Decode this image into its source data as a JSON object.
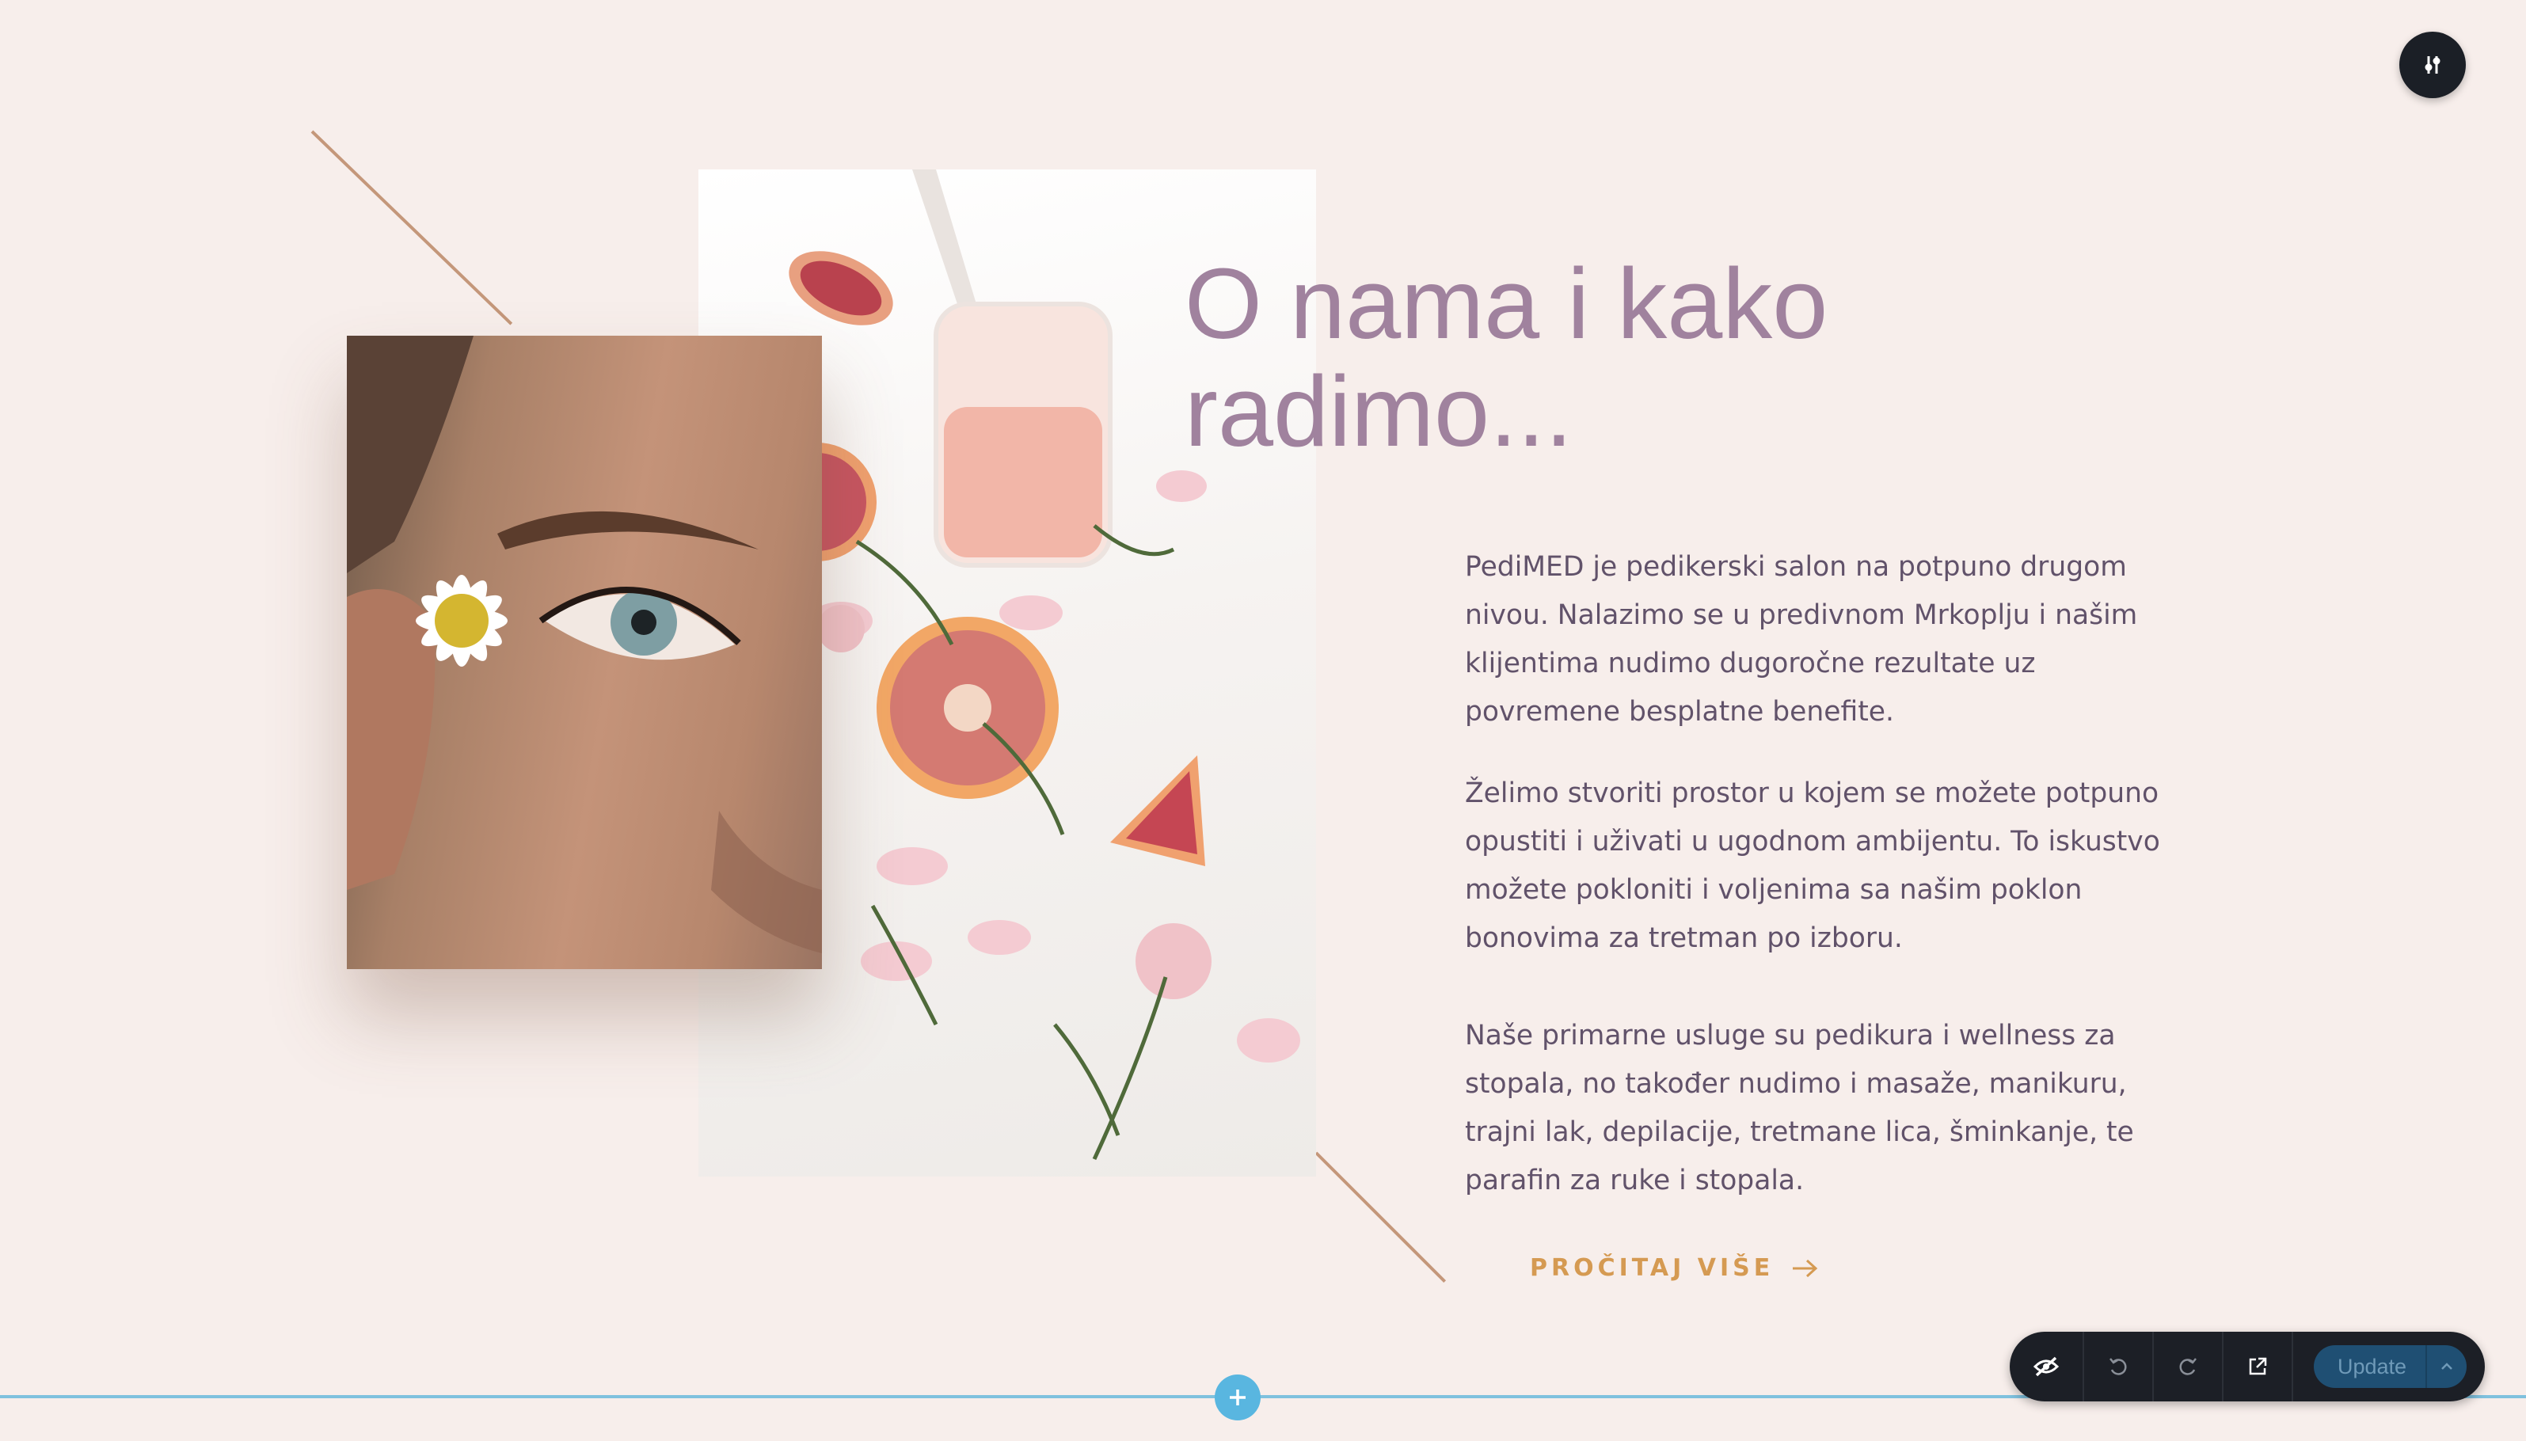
{
  "section": {
    "heading_line1": "O nama i kako",
    "heading_line2": "radimo...",
    "paragraphs": [
      "PediMED je pedikerski salon na potpuno drugom nivou. Nalazimo se u predivnom Mrkoplju i našim klijentima nudimo dugoročne rezultate uz povremene besplatne benefite.",
      "Želimo stvoriti prostor u kojem se možete potpuno opustiti i uživati u ugodnom ambijentu. To iskustvo možete pokloniti i voljenima sa našim poklon bonovima za tretman po izboru.",
      "Naše primarne usluge su pedikura i wellness za stopala, no također nudimo i masaže, manikuru, trajni lak, depilacije, tretmane lica, šminkanje, te parafin za ruke i stopala."
    ],
    "read_more_label": "PROČITAJ VIŠE",
    "read_more_icon": "arrow-right-icon"
  },
  "images": {
    "front": "woman-eye-with-daisy",
    "back": "grapefruit-jar-rose-petals"
  },
  "editor": {
    "settings_icon": "sliders-icon",
    "add_section_icon": "plus-icon",
    "toolbar": {
      "icons": [
        "eye-hidden-icon",
        "undo-icon",
        "redo-icon",
        "external-link-icon"
      ],
      "update_label": "Update",
      "update_dropdown_icon": "chevron-up-icon"
    }
  },
  "colors": {
    "background": "#f7eeeb",
    "heading": "#a0829e",
    "body_text": "#61526a",
    "accent": "#d59a52",
    "line": "#c4977a",
    "divider": "#7fc1de",
    "toolbar": "#1c1f26",
    "update_button": "#1f4f73"
  }
}
